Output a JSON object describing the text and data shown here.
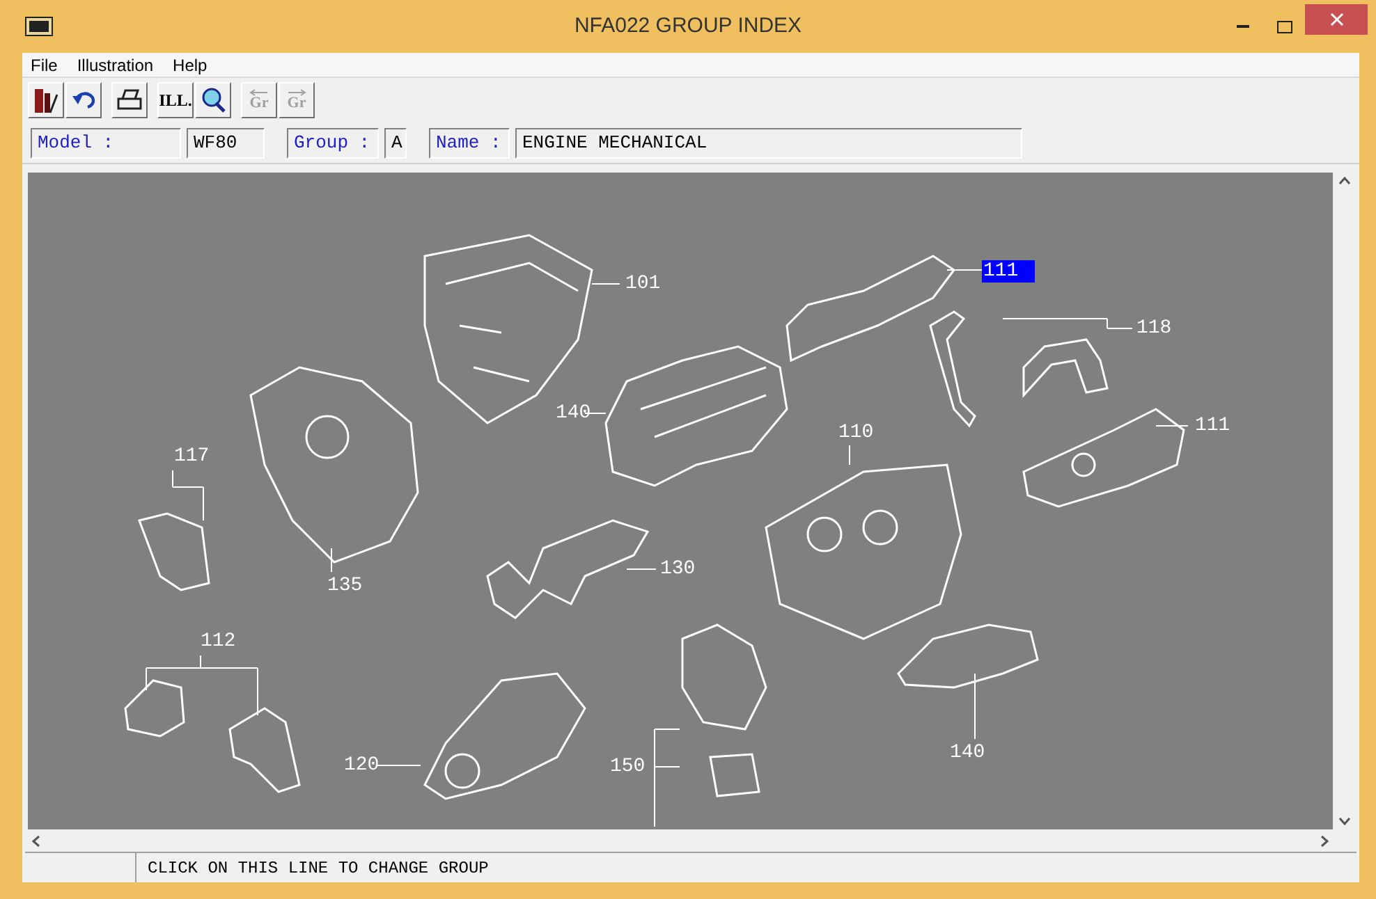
{
  "window": {
    "title": "NFA022 GROUP INDEX"
  },
  "menu": [
    "File",
    "Illustration",
    "Help"
  ],
  "toolbar": [
    {
      "kind": "book",
      "disabled": false
    },
    {
      "kind": "undo",
      "disabled": false
    },
    {
      "kind": "print",
      "disabled": false
    },
    {
      "kind": "text",
      "label": "ILL.",
      "disabled": false
    },
    {
      "kind": "zoom",
      "disabled": false
    },
    {
      "kind": "prev",
      "label": "Gr",
      "disabled": true
    },
    {
      "kind": "next",
      "label": "Gr",
      "disabled": true
    }
  ],
  "fields": [
    {
      "label": "Model :",
      "value": "WF80"
    },
    {
      "label": "Group :",
      "value": "A"
    },
    {
      "label": "Name :",
      "value": "ENGINE MECHANICAL"
    }
  ],
  "illustration": {
    "callouts": [
      {
        "label": "101",
        "selected": false
      },
      {
        "label": "111",
        "selected": true
      },
      {
        "label": "118",
        "selected": false
      },
      {
        "label": "140",
        "selected": false
      },
      {
        "label": "110",
        "selected": false
      },
      {
        "label": "111",
        "selected": false
      },
      {
        "label": "117",
        "selected": false
      },
      {
        "label": "135",
        "selected": false
      },
      {
        "label": "130",
        "selected": false
      },
      {
        "label": "112",
        "selected": false
      },
      {
        "label": "120",
        "selected": false
      },
      {
        "label": "150",
        "selected": false
      },
      {
        "label": "140",
        "selected": false
      }
    ]
  },
  "status_bar": {
    "text": "CLICK ON THIS LINE TO CHANGE GROUP"
  }
}
